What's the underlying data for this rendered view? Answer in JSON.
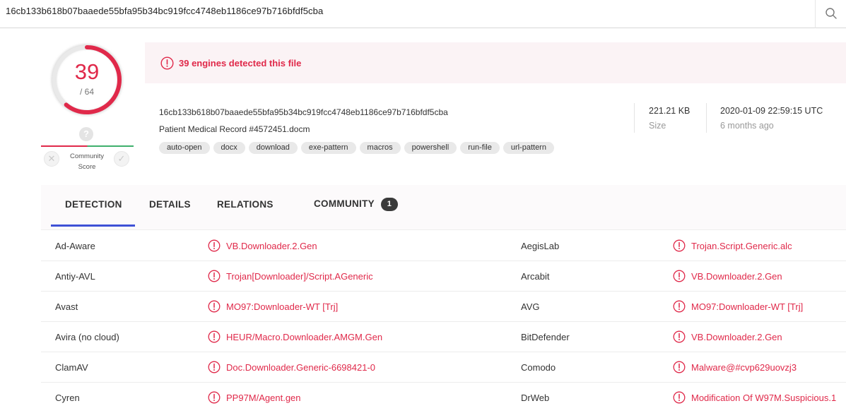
{
  "search": {
    "query": "16cb133b618b07baaede55bfa95b34bc919fcc4748eb1186ce97b716bfdf5cba"
  },
  "score": {
    "detected": "39",
    "total": "/ 64",
    "detected_value": 39,
    "total_value": 64,
    "color": "#e0294a"
  },
  "community": {
    "question": "?",
    "label_line1": "Community",
    "label_line2": "Score"
  },
  "banner": {
    "text": "39 engines detected this file"
  },
  "file": {
    "hash": "16cb133b618b07baaede55bfa95b34bc919fcc4748eb1186ce97b716bfdf5cba",
    "name": "Patient Medical Record #4572451.docm",
    "tags": [
      "auto-open",
      "docx",
      "download",
      "exe-pattern",
      "macros",
      "powershell",
      "run-file",
      "url-pattern"
    ],
    "size_value": "221.21 KB",
    "size_label": "Size",
    "date_value": "2020-01-09 22:59:15 UTC",
    "date_label": "6 months ago"
  },
  "tabs": {
    "detection": "DETECTION",
    "details": "DETAILS",
    "relations": "RELATIONS",
    "community": "COMMUNITY",
    "community_badge": "1"
  },
  "detections": [
    {
      "engine_left": "Ad-Aware",
      "result_left": "VB.Downloader.2.Gen",
      "engine_right": "AegisLab",
      "result_right": "Trojan.Script.Generic.alc"
    },
    {
      "engine_left": "Antiy-AVL",
      "result_left": "Trojan[Downloader]/Script.AGeneric",
      "engine_right": "Arcabit",
      "result_right": "VB.Downloader.2.Gen"
    },
    {
      "engine_left": "Avast",
      "result_left": "MO97:Downloader-WT [Trj]",
      "engine_right": "AVG",
      "result_right": "MO97:Downloader-WT [Trj]"
    },
    {
      "engine_left": "Avira (no cloud)",
      "result_left": "HEUR/Macro.Downloader.AMGM.Gen",
      "engine_right": "BitDefender",
      "result_right": "VB.Downloader.2.Gen"
    },
    {
      "engine_left": "ClamAV",
      "result_left": "Doc.Downloader.Generic-6698421-0",
      "engine_right": "Comodo",
      "result_right": "Malware@#cvp629uovzj3"
    },
    {
      "engine_left": "Cyren",
      "result_left": "PP97M/Agent.gen",
      "engine_right": "DrWeb",
      "result_right": "Modification Of W97M.Suspicious.1"
    }
  ],
  "colors": {
    "accent_red": "#e0294a",
    "tab_underline": "#3f51d6",
    "community_good": "#3fb06c"
  },
  "icons": {
    "search": "search-icon",
    "alert": "alert-circle-icon",
    "thumbs_down": "close-icon",
    "thumbs_up": "check-icon"
  }
}
